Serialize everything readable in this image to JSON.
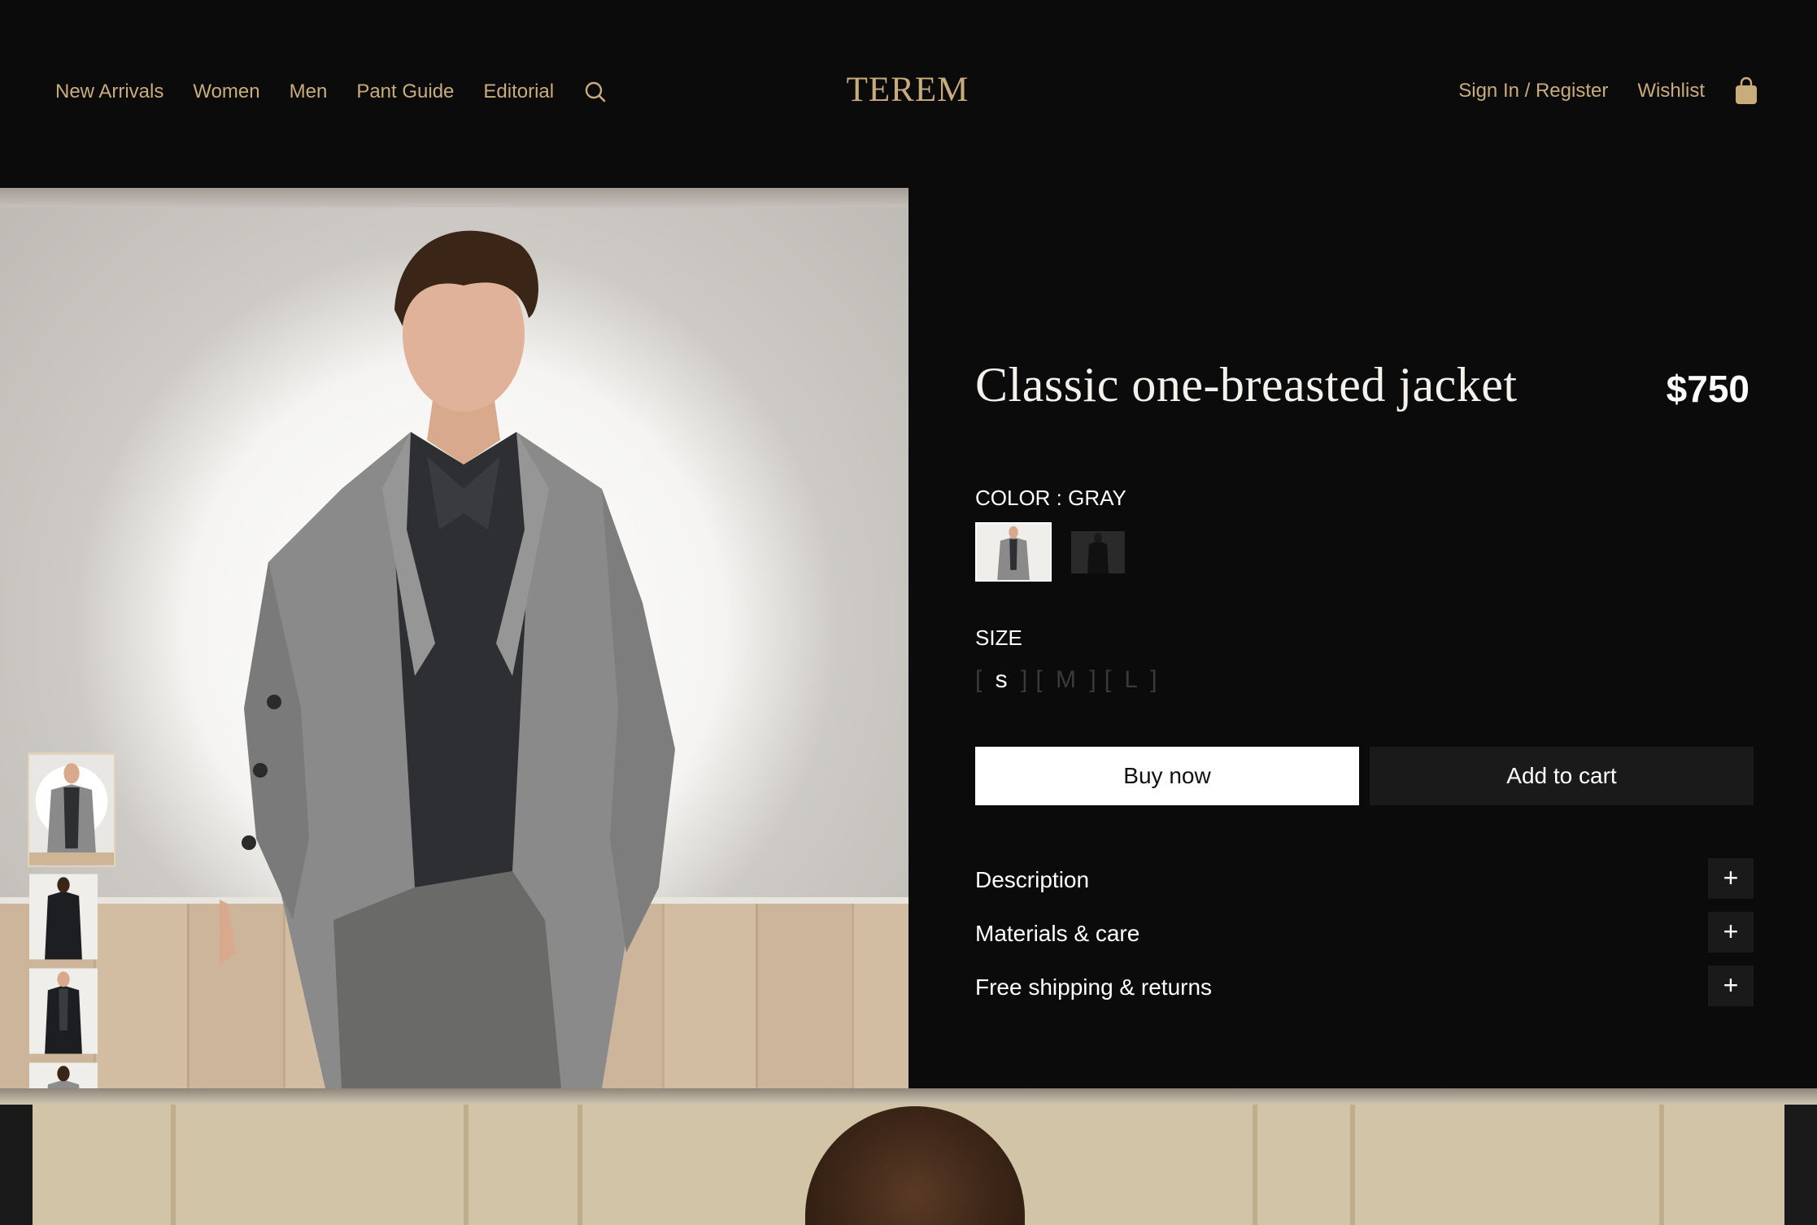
{
  "header": {
    "nav_left": [
      "New Arrivals",
      "Women",
      "Men",
      "Pant Guide",
      "Editorial"
    ],
    "logo": "TEREM",
    "nav_right": [
      "Sign In / Register",
      "Wishlist"
    ],
    "icons": {
      "search": "search-icon",
      "bag": "shopping-bag-icon"
    }
  },
  "colors": {
    "accent": "#c9ac7c",
    "background": "#0b0b0b",
    "button_primary": "#ffffff",
    "button_secondary": "#1a1a1a"
  },
  "product": {
    "title": "Classic one-breasted jacket",
    "price": "$750",
    "color_label": "COLOR : GRAY",
    "color_options": [
      "gray",
      "black"
    ],
    "size_label": "SIZE",
    "sizes": [
      "s",
      "M",
      "L"
    ],
    "selected_size": "s",
    "buy_now": "Buy now",
    "add_to_cart": "Add to cart",
    "accordion": [
      "Description",
      "Materials & care",
      "Free shipping & returns"
    ],
    "accordion_icon": "+"
  },
  "gallery": {
    "thumbnail_count": 5,
    "active_index": 0
  }
}
